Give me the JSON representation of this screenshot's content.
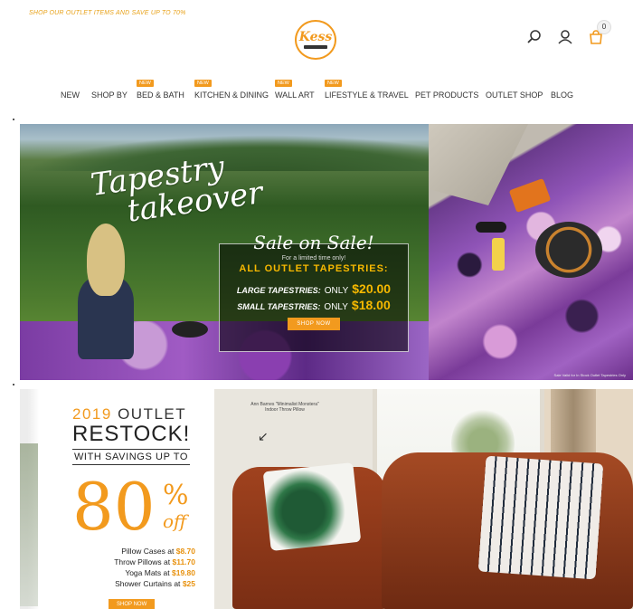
{
  "promo": "SHOP OUR OUTLET ITEMS AND SAVE UP TO 70%",
  "brand": {
    "logo_text": "Kess",
    "accent": "#f29a1e"
  },
  "header": {
    "icons": [
      "search-icon",
      "user-icon",
      "cart-icon"
    ],
    "cart_count": "0"
  },
  "nav": {
    "badge": "NEW",
    "items": [
      {
        "label": "NEW"
      },
      {
        "label": "SHOP BY"
      },
      {
        "label": "BED & BATH",
        "is_new": true
      },
      {
        "label": "KITCHEN & DINING",
        "is_new": true
      },
      {
        "label": "WALL ART",
        "is_new": true
      },
      {
        "label": "LIFESTYLE & TRAVEL",
        "is_new": true
      },
      {
        "label": "PET PRODUCTS"
      },
      {
        "label": "OUTLET SHOP"
      },
      {
        "label": "BLOG"
      }
    ]
  },
  "hero": {
    "title_line1": "Tapestry",
    "title_line2": "takeover",
    "sale_heading": "Sale on Sale!",
    "limited": "For a limited time only!",
    "all_outlet": "ALL OUTLET TAPESTRIES:",
    "large_label": "LARGE TAPESTRIES:",
    "small_label": "SMALL TAPESTRIES:",
    "only": "ONLY",
    "large_price": "$20.00",
    "small_price": "$18.00",
    "cta": "SHOP NOW",
    "fine_print": "Sale Valid for In Stock Outlet Tapestries Only"
  },
  "banner2": {
    "year": "2019",
    "outlet": "OUTLET",
    "restock": "RESTOCK!",
    "savings": "WITH SAVINGS UP TO",
    "percent_number": "80",
    "percent_sign": "%",
    "off": "off",
    "items": [
      {
        "label": "Pillow Cases at",
        "price": "$8.70"
      },
      {
        "label": "Throw Pillows at",
        "price": "$11.70"
      },
      {
        "label": "Yoga Mats at",
        "price": "$19.80"
      },
      {
        "label": "Shower Curtains at",
        "price": "$25"
      }
    ],
    "cta": "SHOP NOW",
    "caption": "Ann Barnes \"Minimalist Monstera\" Indoor Throw Pillow"
  }
}
